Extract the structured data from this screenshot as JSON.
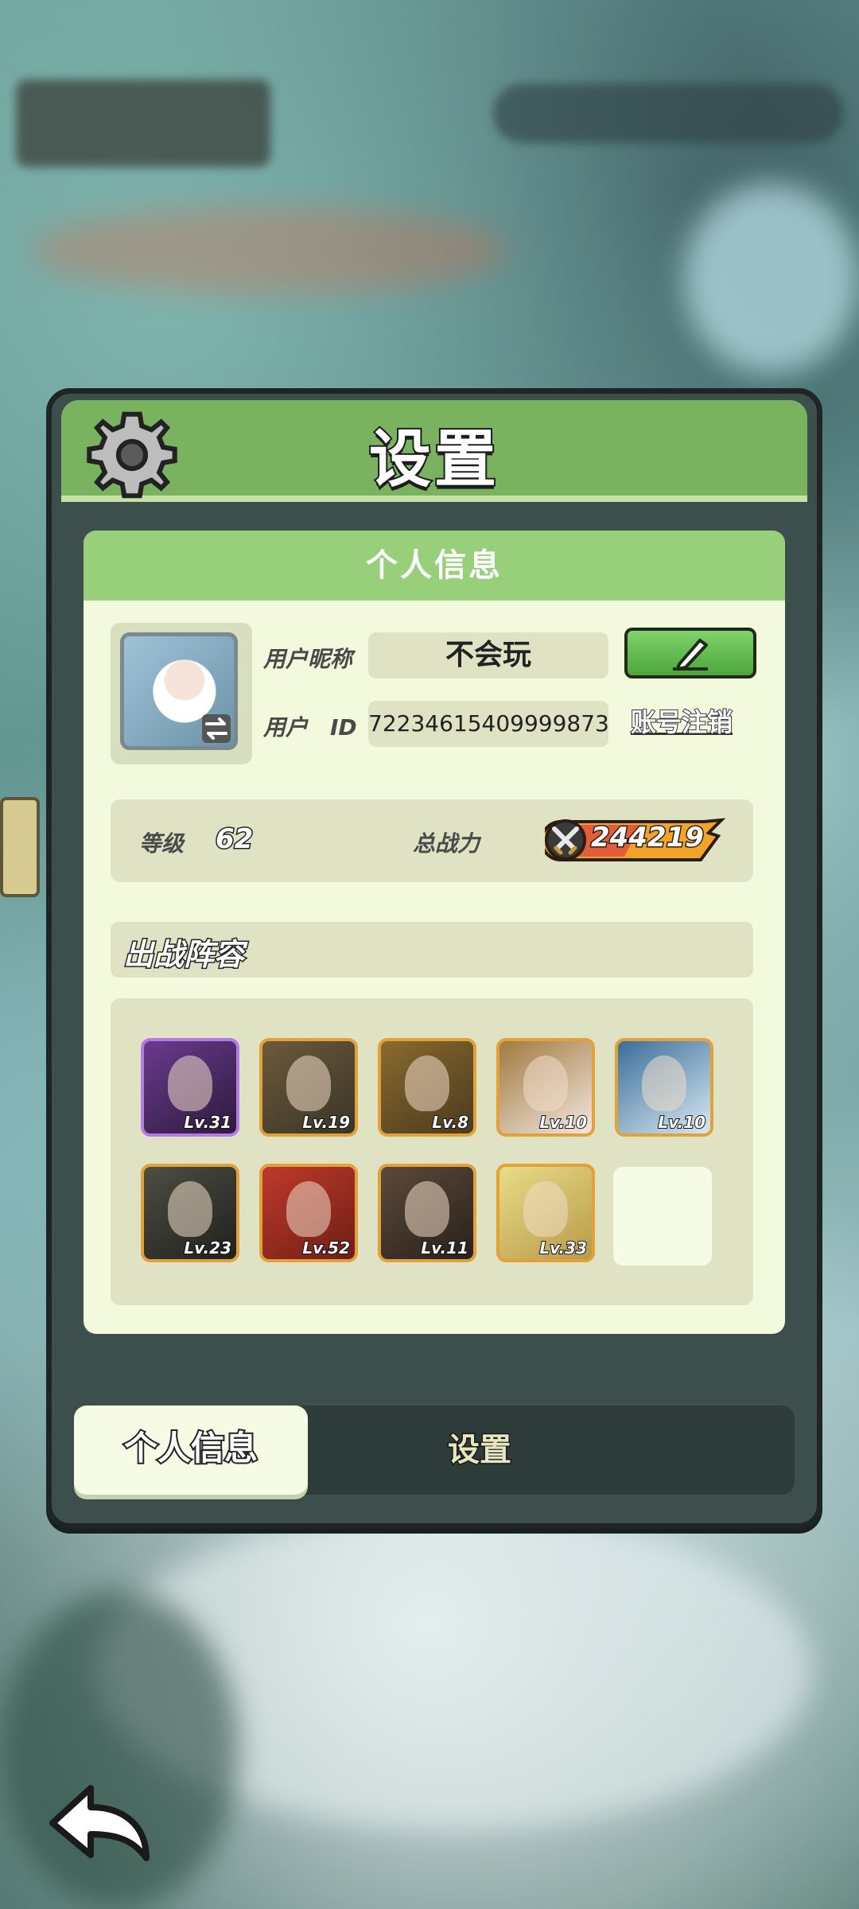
{
  "window": {
    "title": "设置"
  },
  "panel": {
    "title": "设置",
    "section_title": "个人信息",
    "profile": {
      "nickname_label": "用户昵称",
      "nickname": "不会玩",
      "id_label": "用户　ID",
      "user_id": "72234615409999873",
      "cancel_account": "账号注销"
    },
    "stats": {
      "level_label": "等级",
      "level": "62",
      "power_label": "总战力",
      "power": "244219"
    },
    "lineup": {
      "title": "出战阵容",
      "heroes": [
        {
          "level": "Lv.31",
          "frame": "purple",
          "colors": [
            "#6a3b8c",
            "#2e1a3d"
          ]
        },
        {
          "level": "Lv.19",
          "frame": "orange",
          "colors": [
            "#6c5a3a",
            "#3a3428"
          ]
        },
        {
          "level": "Lv.8",
          "frame": "orange",
          "colors": [
            "#8a6a2e",
            "#4a3a1e"
          ]
        },
        {
          "level": "Lv.10",
          "frame": "orange",
          "colors": [
            "#a07a40",
            "#f3e6e0"
          ]
        },
        {
          "level": "Lv.10",
          "frame": "orange",
          "colors": [
            "#3a6e9a",
            "#d8e8f2"
          ]
        },
        {
          "level": "Lv.23",
          "frame": "orange",
          "colors": [
            "#4d4f44",
            "#1e201c"
          ]
        },
        {
          "level": "Lv.52",
          "frame": "orange",
          "colors": [
            "#c0392b",
            "#6e1e16"
          ]
        },
        {
          "level": "Lv.11",
          "frame": "orange",
          "colors": [
            "#5a4a3a",
            "#2a201a"
          ]
        },
        {
          "level": "Lv.33",
          "frame": "orange",
          "colors": [
            "#e8dc88",
            "#b89a4a"
          ]
        }
      ]
    }
  },
  "tabs": [
    {
      "label": "个人信息",
      "active": true
    },
    {
      "label": "设置",
      "active": false
    }
  ],
  "icons": {
    "gear": "gear-icon",
    "edit": "pencil-icon",
    "back": "back-arrow-icon",
    "swap": "swap-icon",
    "power": "crossed-swords-icon"
  },
  "colors": {
    "header_green": "#79b35f",
    "section_green": "#98cf7a",
    "panel_dark": "#3d4f4c",
    "content_bg": "#f3f9dd",
    "button_green": "#4ea63b"
  }
}
